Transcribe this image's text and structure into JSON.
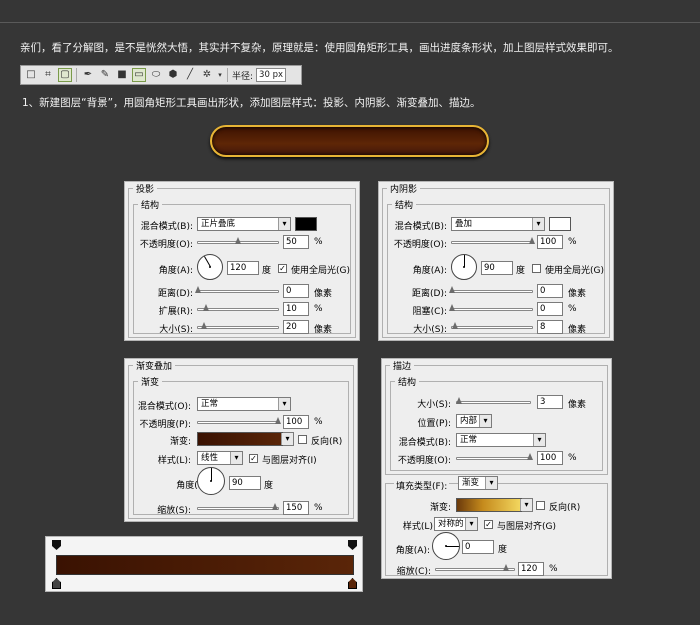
{
  "intro": "亲们，看了分解图，是不是恍然大悟，其实并不复杂，原理就是：使用圆角矩形工具，画出进度条形状，加上图层样式效果即可。",
  "step1": "1、新建图层“背景”，用圆角矩形工具画出形状，添加图层样式：投影、内阴影、渐变叠加、描边。",
  "toolbar": {
    "radius_label": "半径:",
    "radius_value": "30 px"
  },
  "colors": {
    "pill_border": "#e8b535",
    "pill_fill": "#5e2606",
    "gradient_dark": "#3a1202",
    "gradient_light": "#5a2508"
  },
  "drop_shadow": {
    "title": "投影",
    "section": "结构",
    "blend_label": "混合模式(B):",
    "blend_value": "正片叠底",
    "opacity_label": "不透明度(O):",
    "opacity_value": "50",
    "opacity_unit": "%",
    "angle_label": "角度(A):",
    "angle_value": "120",
    "angle_unit": "度",
    "global_label": "使用全局光(G)",
    "distance_label": "距离(D):",
    "distance_value": "0",
    "distance_unit": "像素",
    "spread_label": "扩展(R):",
    "spread_value": "10",
    "spread_unit": "%",
    "size_label": "大小(S):",
    "size_value": "20",
    "size_unit": "像素"
  },
  "inner_shadow": {
    "title": "内阴影",
    "section": "结构",
    "blend_label": "混合模式(B):",
    "blend_value": "叠加",
    "opacity_label": "不透明度(O):",
    "opacity_value": "100",
    "opacity_unit": "%",
    "angle_label": "角度(A):",
    "angle_value": "90",
    "angle_unit": "度",
    "global_label": "使用全局光(G)",
    "distance_label": "距离(D):",
    "distance_value": "0",
    "distance_unit": "像素",
    "choke_label": "阻塞(C):",
    "choke_value": "0",
    "choke_unit": "%",
    "size_label": "大小(S):",
    "size_value": "8",
    "size_unit": "像素"
  },
  "gradient_overlay": {
    "title": "渐变叠加",
    "section": "渐变",
    "blend_label": "混合模式(O):",
    "blend_value": "正常",
    "opacity_label": "不透明度(P):",
    "opacity_value": "100",
    "opacity_unit": "%",
    "gradient_label": "渐变:",
    "reverse_label": "反向(R)",
    "style_label": "样式(L):",
    "style_value": "线性",
    "align_label": "与图层对齐(I)",
    "angle_label": "角度(N):",
    "angle_value": "90",
    "angle_unit": "度",
    "scale_label": "缩放(S):",
    "scale_value": "150",
    "scale_unit": "%"
  },
  "stroke": {
    "title": "描边",
    "section": "结构",
    "size_label": "大小(S):",
    "size_value": "3",
    "size_unit": "像素",
    "position_label": "位置(P):",
    "position_value": "内部",
    "blend_label": "混合模式(B):",
    "blend_value": "正常",
    "opacity_label": "不透明度(O):",
    "opacity_value": "100",
    "opacity_unit": "%",
    "fill_type_label": "填充类型(F):",
    "fill_type_value": "渐变",
    "gradient_label": "渐变:",
    "reverse_label": "反向(R)",
    "style_label": "样式(L):",
    "style_value": "对称的",
    "align_label": "与图层对齐(G)",
    "angle_label": "角度(A):",
    "angle_value": "0",
    "angle_unit": "度",
    "scale_label": "缩放(C):",
    "scale_value": "120",
    "scale_unit": "%"
  },
  "levels": {
    "ds_opacity": 0.5,
    "ds_distance": 0.0,
    "ds_spread": 0.1,
    "ds_size": 0.08,
    "is_opacity": 1.0,
    "is_distance": 0.0,
    "is_choke": 0.0,
    "is_size": 0.04,
    "go_opacity": 1.0,
    "go_scale": 0.96,
    "st_size": 0.03,
    "st_opacity": 1.0,
    "st_scale": 0.9
  }
}
